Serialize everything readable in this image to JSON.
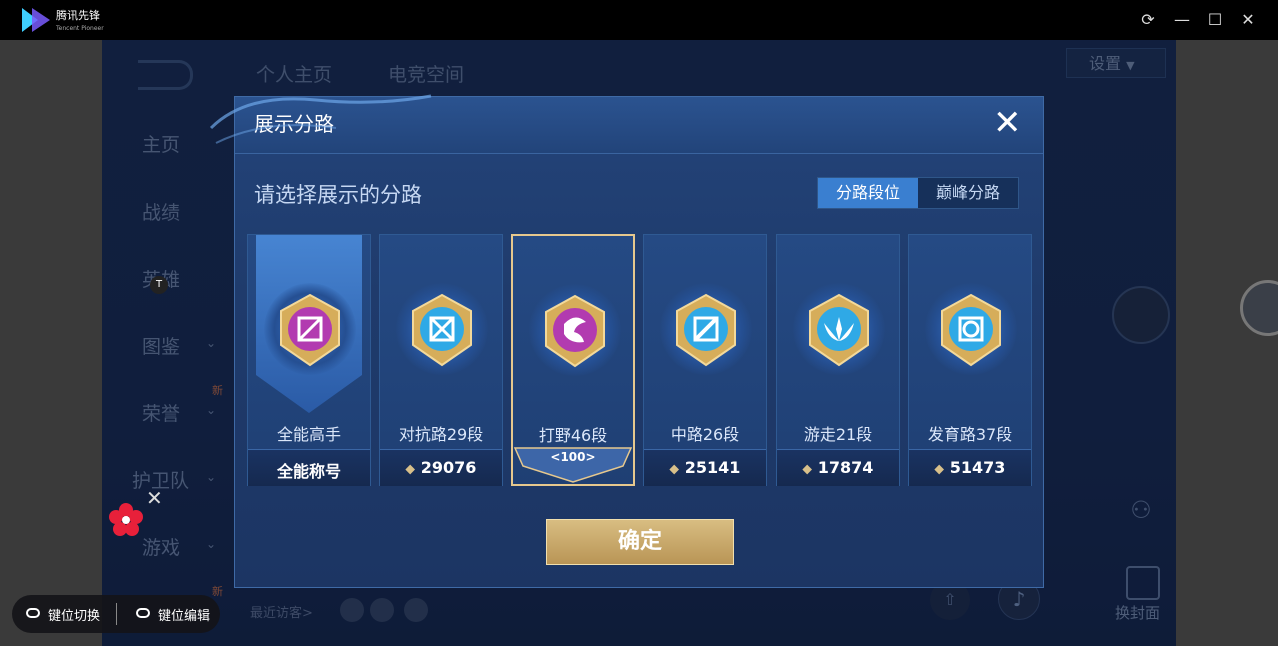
{
  "app": {
    "name": "腾讯先锋",
    "subname": "Tencent Pioneer"
  },
  "window_controls": {
    "refresh_icon": "refresh-icon",
    "minimize_icon": "minimize-icon",
    "maximize_icon": "maximize-icon",
    "close_icon": "close-icon"
  },
  "background": {
    "top_tabs": [
      "个人主页",
      "电竞空间"
    ],
    "settings_label": "设置",
    "nav_items": [
      "主页",
      "战绩",
      "英雄",
      "图鉴",
      "荣誉",
      "护卫队",
      "游戏"
    ],
    "new_badge": "新",
    "recent_visitors": "最近访客>",
    "change_cover": "换封面",
    "t_marker": "T"
  },
  "modal": {
    "title": "展示分路",
    "prompt": "请选择展示的分路",
    "toggle": {
      "active": "分路段位",
      "inactive": "巅峰分路"
    },
    "cards": [
      {
        "rank": "全能高手",
        "score": "全能称号",
        "color": "#b23bb0",
        "selected": false
      },
      {
        "rank": "对抗路29段",
        "score": "29076",
        "color": "#2fa9e6",
        "selected": false
      },
      {
        "rank": "打野46段",
        "score": "",
        "level": "<100>",
        "color": "#b23bb0",
        "selected": true
      },
      {
        "rank": "中路26段",
        "score": "25141",
        "color": "#2fa9e6",
        "selected": false
      },
      {
        "rank": "游走21段",
        "score": "17874",
        "color": "#2fa9e6",
        "selected": false
      },
      {
        "rank": "发育路37段",
        "score": "51473",
        "color": "#2fa9e6",
        "selected": false
      }
    ],
    "confirm_label": "确定"
  },
  "keybar": {
    "switch_label": "键位切换",
    "edit_label": "键位编辑"
  }
}
